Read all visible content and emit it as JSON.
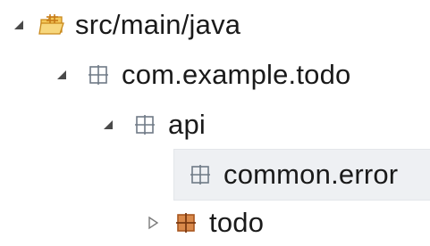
{
  "tree": {
    "items": [
      {
        "label": "src/main/java",
        "expanded": true,
        "icon": "source-folder-icon"
      },
      {
        "label": "com.example.todo",
        "expanded": true,
        "icon": "package-icon"
      },
      {
        "label": "api",
        "expanded": true,
        "icon": "package-icon"
      },
      {
        "label": "common.error",
        "expanded": null,
        "icon": "package-icon",
        "selected": true
      },
      {
        "label": "todo",
        "expanded": false,
        "icon": "package-icon"
      }
    ]
  },
  "colors": {
    "folder_accent": "#e0a32e",
    "package_outline": "#6f7a86",
    "package_filled": "#b5652b",
    "selection_bg": "#eef0f3"
  }
}
